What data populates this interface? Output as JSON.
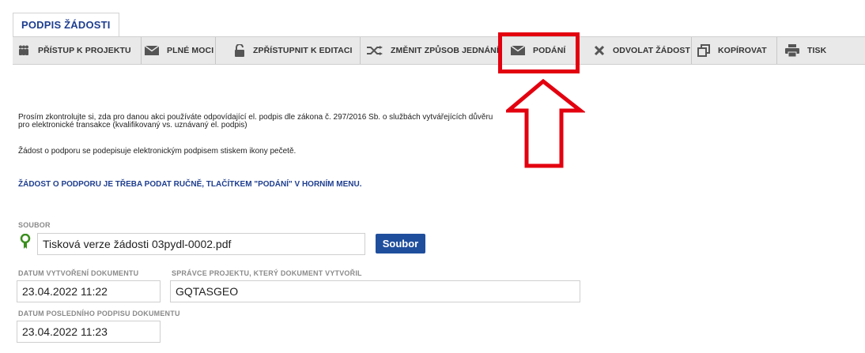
{
  "tab": {
    "title": "PODPIS ŽÁDOSTI"
  },
  "toolbar": {
    "items": [
      {
        "label": "PŘÍSTUP K PROJEKTU",
        "icon": "people-icon"
      },
      {
        "label": "PLNÉ MOCI",
        "icon": "envelope-icon"
      },
      {
        "label": "ZPŘÍSTUPNIT K EDITACI",
        "icon": "unlock-icon"
      },
      {
        "label": "ZMĚNIT ZPŮSOB JEDNÁNÍ",
        "icon": "shuffle-icon"
      },
      {
        "label": "PODÁNÍ",
        "icon": "envelope-icon"
      },
      {
        "label": "ODVOLAT ŽÁDOST",
        "icon": "close-icon"
      },
      {
        "label": "KOPÍROVAT",
        "icon": "copy-icon"
      },
      {
        "label": "TISK",
        "icon": "printer-icon"
      }
    ]
  },
  "content": {
    "info_line1": "Prosím zkontrolujte si, zda pro danou akci používáte odpovídající el. podpis dle zákona č. 297/2016 Sb. o službách vytvářejících důvěru",
    "info_line2": "pro elektronické transakce (kvalifikovaný vs. uznávaný el. podpis)",
    "info_sign": "Žádost o podporu se podepisuje elektronickým podpisem stiskem ikony pečetě.",
    "notice": "ŽÁDOST O PODPORU JE TŘEBA PODAT RUČNĚ, TLAČÍTKEM \"PODÁNÍ\" V HORNÍM MENU."
  },
  "form": {
    "file_label": "SOUBOR",
    "file_name": "Tisková verze žádosti 03pydl-0002.pdf",
    "file_button": "Soubor",
    "created_label": "DATUM VYTVOŘENÍ DOKUMENTU",
    "created_value": "23.04.2022 11:22",
    "admin_label": "SPRÁVCE PROJEKTU, KTERÝ DOKUMENT VYTVOŘIL",
    "admin_value": "GQTASGEO",
    "last_sign_label": "DATUM POSLEDNÍHO PODPISU DOKUMENTU",
    "last_sign_value": "23.04.2022 11:23"
  },
  "colors": {
    "accent_blue": "#1e3e8f",
    "button_blue": "#1f4e9d",
    "highlight_red": "#e3000f",
    "seal_green": "#3a8f1d"
  }
}
